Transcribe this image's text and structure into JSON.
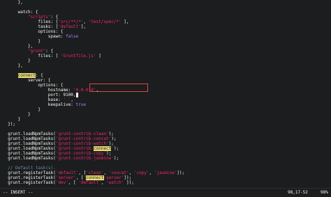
{
  "colors": {
    "background": "#1b1d1e",
    "text": "#f8f8f2",
    "string": "#e6db74",
    "key": "#f92672",
    "keyword_orange": "#fd971f",
    "boolean": "#ae81ff",
    "comment": "#6a8fb5",
    "highlight_yellow": "#e6db74",
    "box_red": "#e04848"
  },
  "editor": {
    "lines": [
      {
        "indent": 6,
        "tokens": [
          {
            "t": "},",
            "c": "text"
          }
        ]
      },
      {
        "indent": 0,
        "tokens": []
      },
      {
        "indent": 6,
        "tokens": [
          {
            "t": "watch: {",
            "c": "text"
          }
        ]
      },
      {
        "indent": 10,
        "tokens": [
          {
            "t": "\"scripts\"",
            "c": "key"
          },
          {
            "t": ": {",
            "c": "text"
          }
        ]
      },
      {
        "indent": 14,
        "tokens": [
          {
            "t": "files: [",
            "c": "text"
          },
          {
            "t": "'src/**/*'",
            "c": "key"
          },
          {
            "t": ", ",
            "c": "text"
          },
          {
            "t": "'test/spec/*'",
            "c": "key"
          },
          {
            "t": " ],",
            "c": "text"
          }
        ]
      },
      {
        "indent": 14,
        "tokens": [
          {
            "t": "tasks: [",
            "c": "text"
          },
          {
            "t": "'default'",
            "c": "key"
          },
          {
            "t": "],",
            "c": "text"
          }
        ]
      },
      {
        "indent": 14,
        "tokens": [
          {
            "t": "options: {",
            "c": "text"
          }
        ]
      },
      {
        "indent": 18,
        "tokens": [
          {
            "t": "spawn: ",
            "c": "text"
          },
          {
            "t": "false",
            "c": "boolean"
          }
        ]
      },
      {
        "indent": 14,
        "tokens": [
          {
            "t": "}",
            "c": "text"
          }
        ]
      },
      {
        "indent": 10,
        "tokens": [
          {
            "t": "},",
            "c": "text"
          }
        ]
      },
      {
        "indent": 10,
        "tokens": [
          {
            "t": "\"grunt\"",
            "c": "key"
          },
          {
            "t": ": {",
            "c": "text"
          }
        ]
      },
      {
        "indent": 14,
        "tokens": [
          {
            "t": "files: [ ",
            "c": "text"
          },
          {
            "t": "'Gruntfile.js'",
            "c": "key"
          },
          {
            "t": " ]",
            "c": "text"
          }
        ]
      },
      {
        "indent": 10,
        "tokens": [
          {
            "t": "}",
            "c": "text"
          }
        ]
      },
      {
        "indent": 6,
        "tokens": [
          {
            "t": "},",
            "c": "text"
          }
        ]
      },
      {
        "indent": 0,
        "tokens": []
      },
      {
        "indent": 6,
        "tokens": [
          {
            "t": "connect",
            "c": "hl-yellow"
          },
          {
            "t": ": {",
            "c": "text"
          }
        ]
      },
      {
        "indent": 10,
        "tokens": [
          {
            "t": "server: {",
            "c": "text"
          }
        ]
      },
      {
        "indent": 14,
        "tokens": [
          {
            "t": "options: {",
            "c": "text"
          }
        ]
      },
      {
        "indent": 18,
        "tokens": [
          {
            "t": "hostname: ",
            "c": "text"
          },
          {
            "t": "'0.0.0.0'",
            "c": "key"
          },
          {
            "t": ",",
            "c": "text"
          }
        ]
      },
      {
        "indent": 18,
        "tokens": [
          {
            "t": "port: 9100,",
            "c": "text"
          },
          {
            "t": " ",
            "c": "cursor"
          }
        ]
      },
      {
        "indent": 18,
        "tokens": [
          {
            "t": "base: ",
            "c": "text"
          },
          {
            "t": "'.'",
            "c": "key"
          },
          {
            "t": ",",
            "c": "text"
          }
        ]
      },
      {
        "indent": 18,
        "tokens": [
          {
            "t": "keepalive: ",
            "c": "text"
          },
          {
            "t": "true",
            "c": "boolean"
          }
        ]
      },
      {
        "indent": 14,
        "tokens": [
          {
            "t": "}",
            "c": "text"
          }
        ]
      },
      {
        "indent": 10,
        "tokens": [
          {
            "t": "}",
            "c": "text"
          }
        ]
      },
      {
        "indent": 6,
        "tokens": [
          {
            "t": "}",
            "c": "text"
          }
        ]
      },
      {
        "indent": 2,
        "tokens": [
          {
            "t": "});",
            "c": "text"
          }
        ]
      },
      {
        "indent": 0,
        "tokens": []
      },
      {
        "indent": 2,
        "tokens": [
          {
            "t": "grunt.loadNpmTasks(",
            "c": "text"
          },
          {
            "t": "'grunt-contrib-clean'",
            "c": "key"
          },
          {
            "t": ");",
            "c": "text"
          }
        ]
      },
      {
        "indent": 2,
        "tokens": [
          {
            "t": "grunt.loadNpmTasks(",
            "c": "text"
          },
          {
            "t": "'grunt-contrib-concat'",
            "c": "key"
          },
          {
            "t": ");",
            "c": "text"
          }
        ]
      },
      {
        "indent": 2,
        "tokens": [
          {
            "t": "grunt.loadNpmTasks(",
            "c": "text"
          },
          {
            "t": "'grunt-contrib-watch'",
            "c": "key"
          },
          {
            "t": ");",
            "c": "text"
          }
        ]
      },
      {
        "indent": 2,
        "tokens": [
          {
            "t": "grunt.loadNpmTasks(",
            "c": "text"
          },
          {
            "t": "'grunt-contrib-",
            "c": "key"
          },
          {
            "t": "connect",
            "c": "hl-yellow"
          },
          {
            "t": "'",
            "c": "key"
          },
          {
            "t": ");",
            "c": "text"
          }
        ]
      },
      {
        "indent": 2,
        "tokens": [
          {
            "t": "grunt.loadNpmTasks(",
            "c": "text"
          },
          {
            "t": "'grunt-contrib-copy'",
            "c": "key"
          },
          {
            "t": ");",
            "c": "text"
          }
        ]
      },
      {
        "indent": 2,
        "tokens": [
          {
            "t": "grunt.loadNpmTasks(",
            "c": "text"
          },
          {
            "t": "'grunt-contrib-jasmine'",
            "c": "key"
          },
          {
            "t": ");",
            "c": "text"
          }
        ]
      },
      {
        "indent": 0,
        "tokens": []
      },
      {
        "indent": 2,
        "tokens": [
          {
            "t": "// Default task(s).",
            "c": "comment"
          }
        ]
      },
      {
        "indent": 2,
        "tokens": [
          {
            "t": "grunt.registerTask(",
            "c": "text"
          },
          {
            "t": "'default'",
            "c": "key"
          },
          {
            "t": ", [",
            "c": "text"
          },
          {
            "t": "'clean'",
            "c": "key"
          },
          {
            "t": ", ",
            "c": "text"
          },
          {
            "t": "'concat'",
            "c": "key"
          },
          {
            "t": ", ",
            "c": "text"
          },
          {
            "t": "'copy'",
            "c": "key"
          },
          {
            "t": ", ",
            "c": "text"
          },
          {
            "t": "'jasmine'",
            "c": "key"
          },
          {
            "t": "]);",
            "c": "text"
          }
        ]
      },
      {
        "indent": 2,
        "tokens": [
          {
            "t": "grunt.registerTask(",
            "c": "text"
          },
          {
            "t": "'server'",
            "c": "key"
          },
          {
            "t": ", [",
            "c": "text"
          },
          {
            "t": "'",
            "c": "key"
          },
          {
            "t": "connect",
            "c": "hl-yellow"
          },
          {
            "t": ":server'",
            "c": "key"
          },
          {
            "t": "]);",
            "c": "text"
          }
        ]
      },
      {
        "indent": 2,
        "tokens": [
          {
            "t": "grunt.registerTask(",
            "c": "text"
          },
          {
            "t": "'dev'",
            "c": "key"
          },
          {
            "t": ", [ ",
            "c": "text"
          },
          {
            "t": "'default'",
            "c": "key"
          },
          {
            "t": ", ",
            "c": "text"
          },
          {
            "t": "'watch'",
            "c": "key"
          },
          {
            "t": " ]);",
            "c": "text"
          }
        ]
      }
    ]
  },
  "statusbar": {
    "mode": "-- INSERT --",
    "position": "98,17-52",
    "percent": "98%"
  }
}
